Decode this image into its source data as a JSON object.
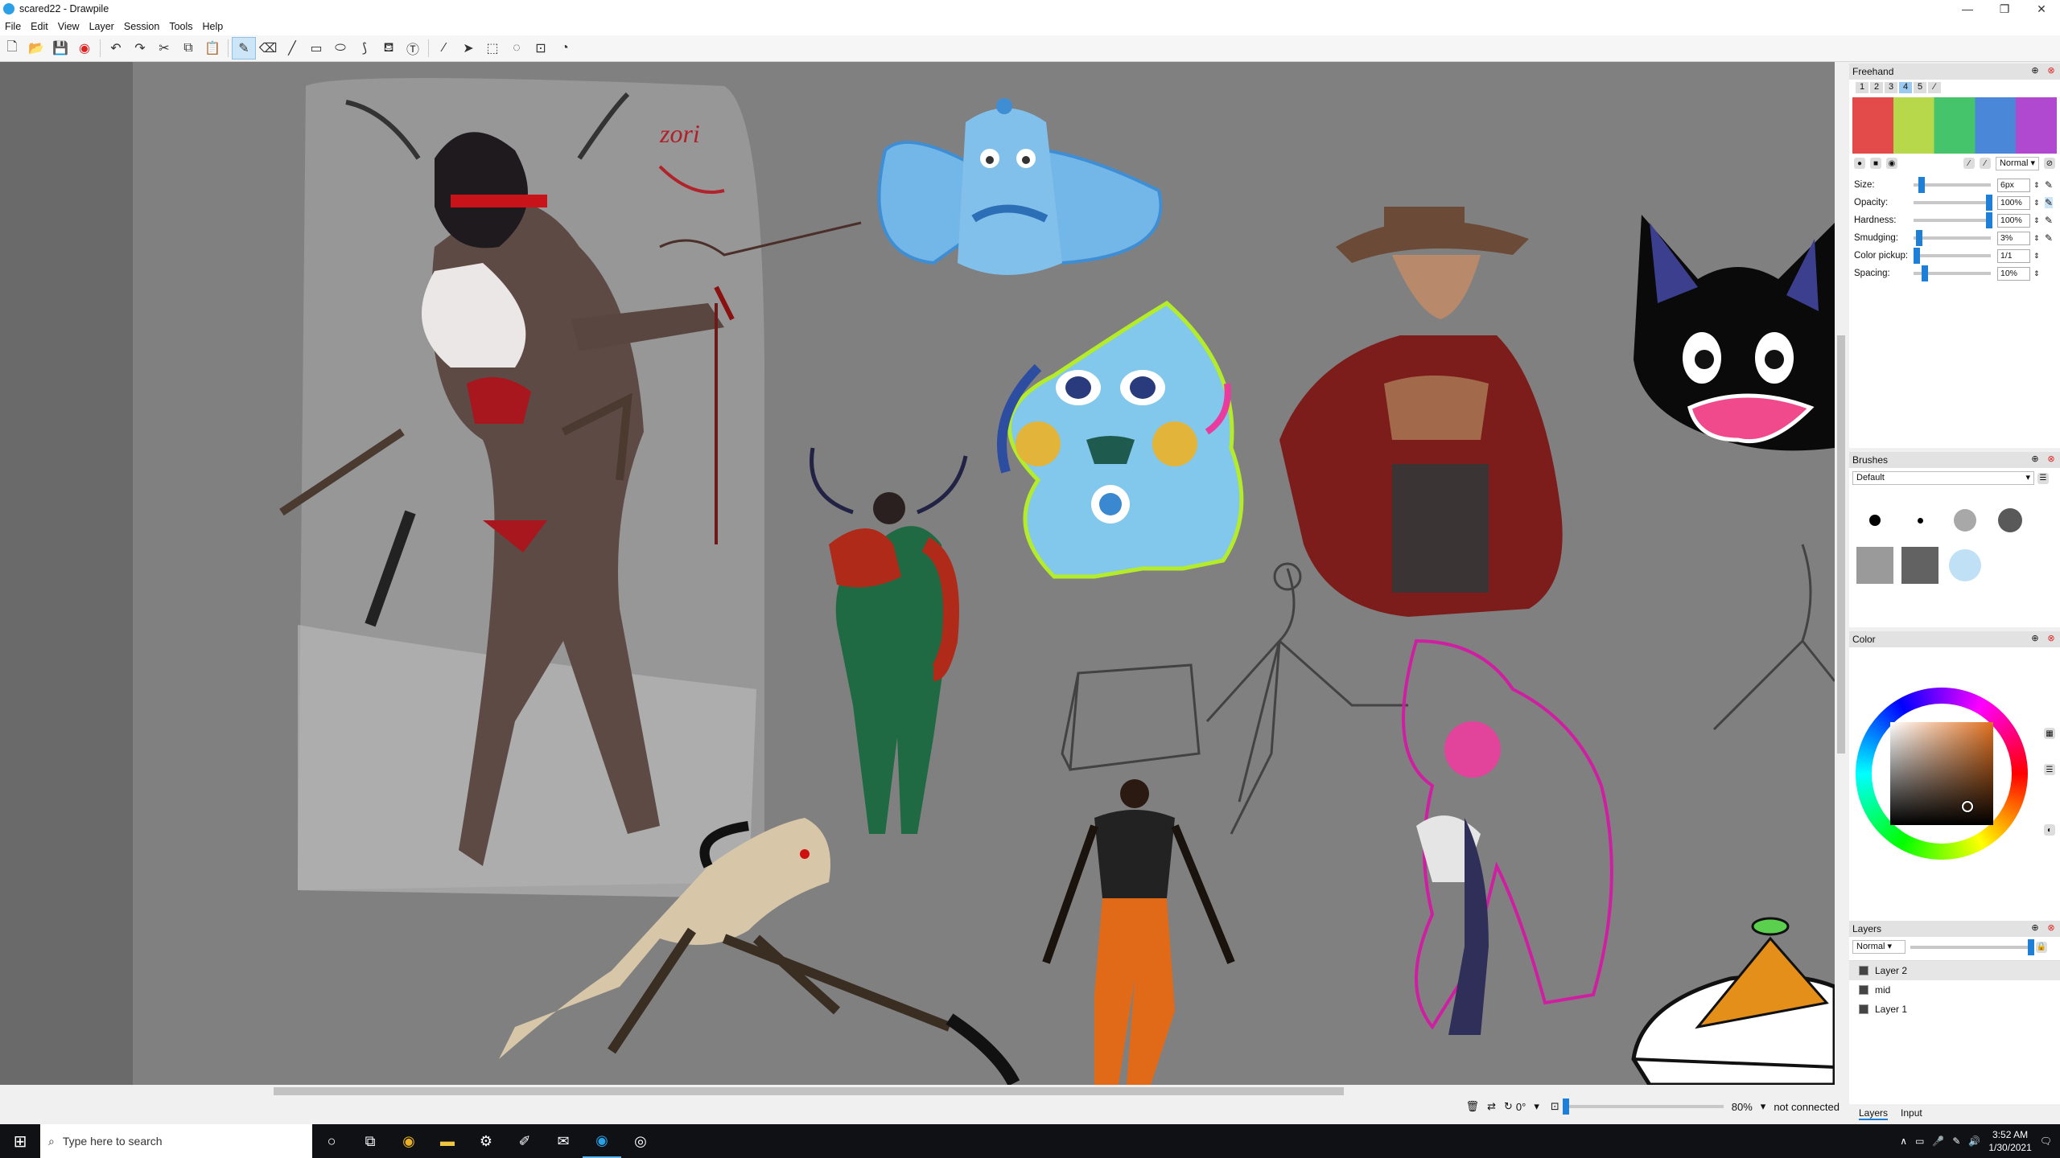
{
  "window": {
    "title": "scared22 - Drawpile",
    "min": "—",
    "max": "❐",
    "close": "✕"
  },
  "menu": [
    "File",
    "Edit",
    "View",
    "Layer",
    "Session",
    "Tools",
    "Help"
  ],
  "freehand": {
    "title": "Freehand",
    "slots": [
      "1",
      "2",
      "3",
      "4",
      "5"
    ],
    "blend_mode": "Normal",
    "settings": [
      {
        "label": "Size:",
        "value": "6px",
        "level": 0.06
      },
      {
        "label": "Opacity:",
        "value": "100%",
        "level": 1.0
      },
      {
        "label": "Hardness:",
        "value": "100%",
        "level": 1.0
      },
      {
        "label": "Smudging:",
        "value": "3%",
        "level": 0.03
      },
      {
        "label": "Color pickup:",
        "value": "1/1",
        "level": 0.0
      },
      {
        "label": "Spacing:",
        "value": "10%",
        "level": 0.1
      }
    ]
  },
  "brushes": {
    "title": "Brushes",
    "preset": "Default"
  },
  "color": {
    "title": "Color"
  },
  "layers": {
    "title": "Layers",
    "blend_mode": "Normal",
    "items": [
      "Layer 2",
      "mid",
      "Layer 1"
    ],
    "tabs": [
      "Layers",
      "Input"
    ]
  },
  "status": {
    "rotation": "0°",
    "zoom": "80%",
    "connection": "not connected"
  },
  "taskbar": {
    "search_placeholder": "Type here to search",
    "time": "3:52 AM",
    "date": "1/30/2021"
  },
  "canvas_text": {
    "signature": "zori"
  }
}
